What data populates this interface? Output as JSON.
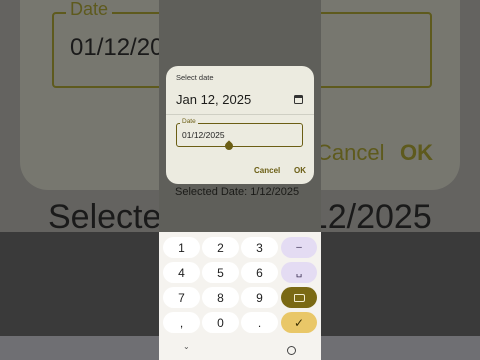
{
  "background": {
    "field_label": "Date",
    "field_value": "01/12/2025",
    "cancel": "Cancel",
    "ok": "OK",
    "selected_text": "Selected Date: 1/12/2025"
  },
  "dialog": {
    "title": "Select date",
    "headline_date": "Jan 12, 2025",
    "field_label": "Date",
    "field_value": "01/12/2025",
    "cancel_label": "Cancel",
    "ok_label": "OK"
  },
  "app": {
    "selected_text": "Selected Date: 1/12/2025"
  },
  "keyboard": {
    "rows": [
      [
        "1",
        "2",
        "3",
        "–"
      ],
      [
        "4",
        "5",
        "6",
        "␣"
      ],
      [
        "7",
        "8",
        "9",
        "⌫"
      ],
      [
        ",",
        "0",
        ".",
        "✓"
      ]
    ]
  },
  "colors": {
    "accent": "#6b5e14",
    "enter_key": "#e9c768",
    "delete_key": "#7a6914",
    "dialog_bg": "#ecebe0"
  }
}
